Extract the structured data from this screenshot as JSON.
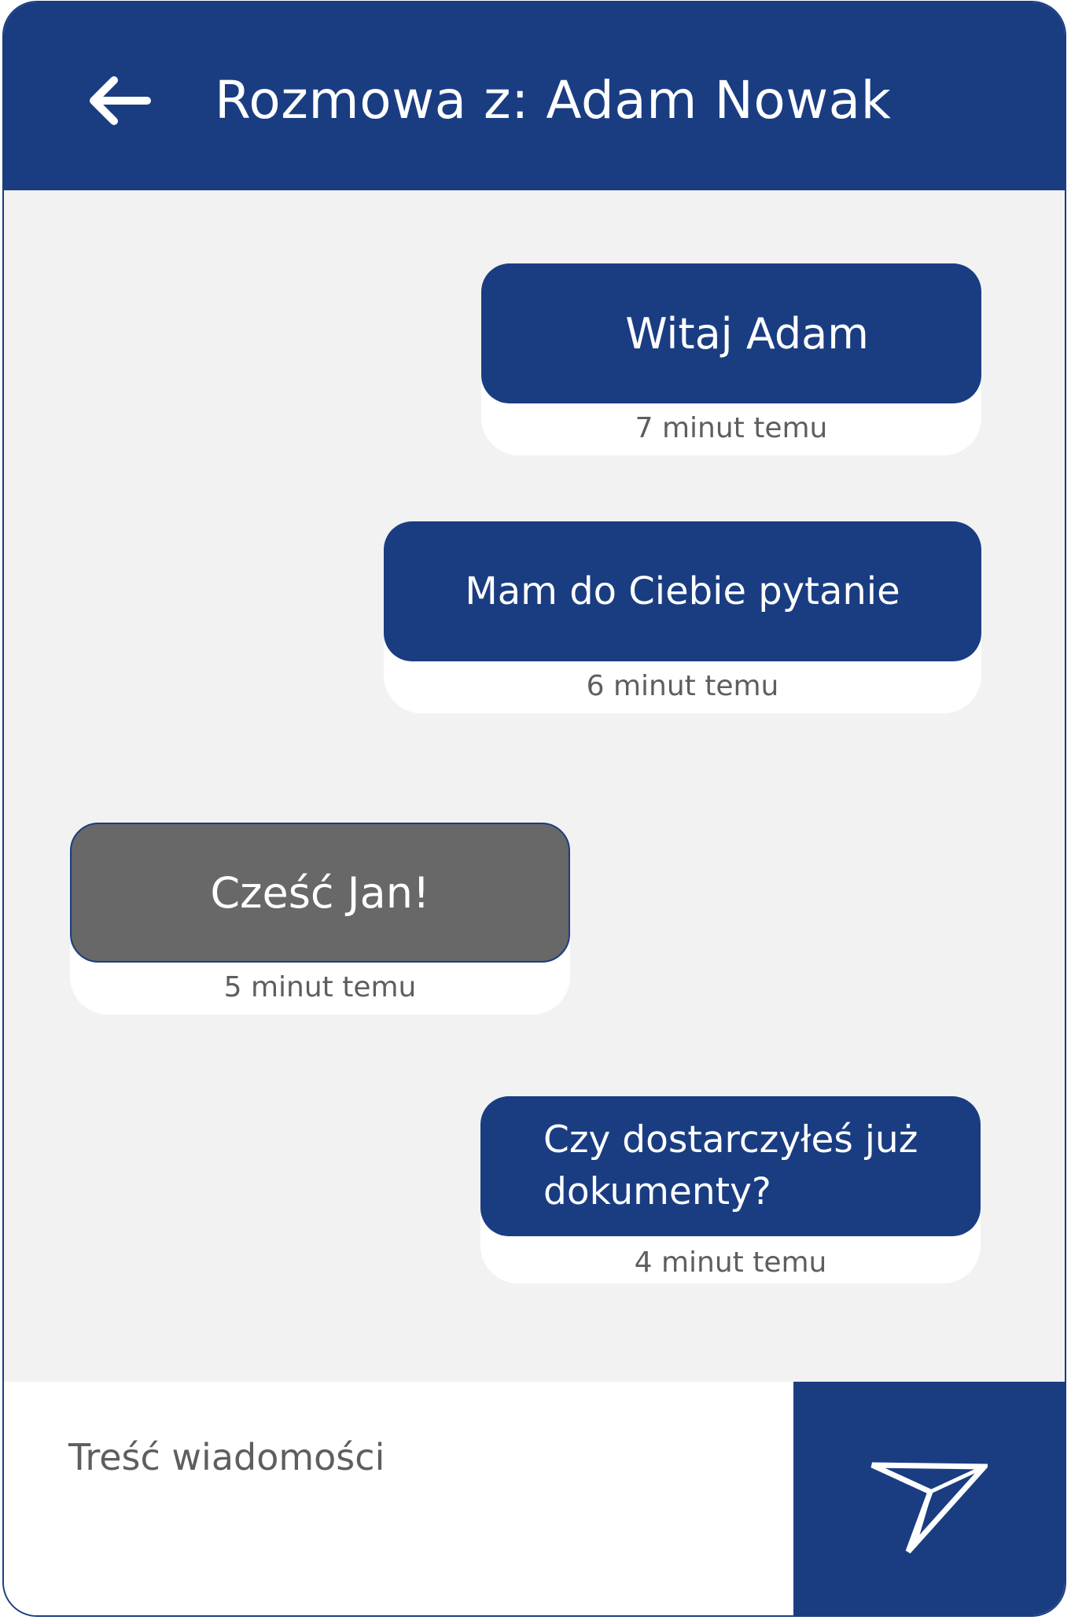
{
  "header": {
    "title": "Rozmowa z: Adam Nowak",
    "back_icon": "arrow-left-icon"
  },
  "messages": [
    {
      "side": "outgoing",
      "text": "Witaj Adam",
      "time": "7 minut temu"
    },
    {
      "side": "outgoing",
      "text": "Mam do Ciebie pytanie",
      "time": "6 minut temu"
    },
    {
      "side": "incoming",
      "text": "Cześć Jan!",
      "time": "5 minut temu"
    },
    {
      "side": "outgoing",
      "text": "Czy dostarczyłeś już dokumenty?",
      "time": "4 minut temu"
    }
  ],
  "composer": {
    "placeholder": "Treść wiadomości",
    "send_icon": "paper-plane-icon"
  },
  "colors": {
    "primary": "#1a3d82",
    "incoming_bubble": "#686868",
    "chat_background": "#f2f2f2",
    "timestamp_text": "#5e5e5e"
  }
}
